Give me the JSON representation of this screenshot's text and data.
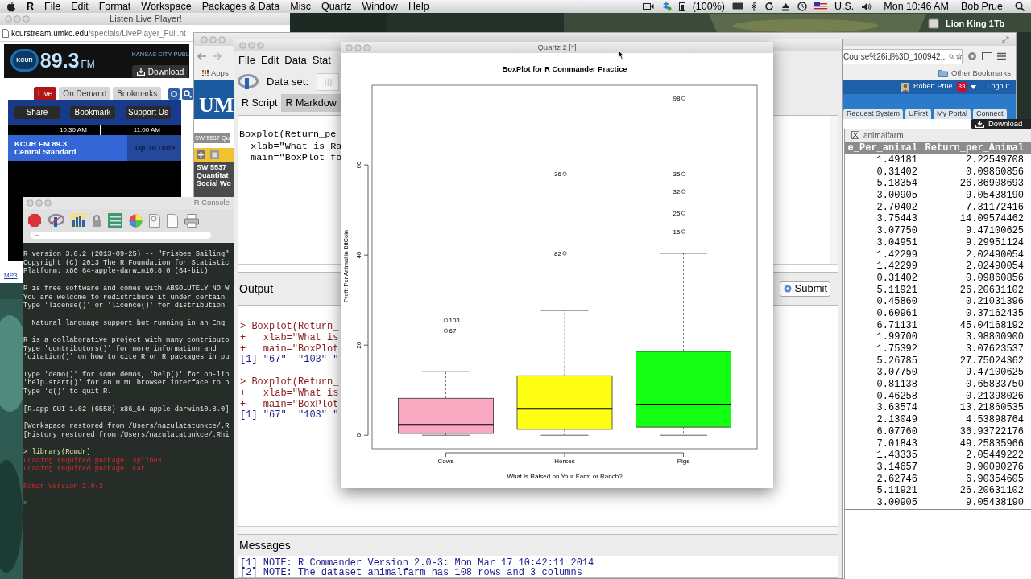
{
  "menu_bar": {
    "app": "R",
    "items": [
      "File",
      "Edit",
      "Format",
      "Workspace",
      "Packages & Data",
      "Misc",
      "Quartz",
      "Window",
      "Help"
    ],
    "battery": "(100%)",
    "input_source": "U.S.",
    "clock": "Mon 10:46 AM",
    "user": "Bob Prue"
  },
  "desktop_icons": [
    {
      "label": "Lion King 1Tb"
    }
  ],
  "radio_window": {
    "title": "Listen Live Player!",
    "url_host": "kcurstream.umkc.edu",
    "url_path": "/specials/LivePlayer_Full.ht",
    "logo": "KCUR",
    "frequency": "89.3",
    "band": "FM",
    "station": "KANSAS CITY PUBL",
    "download": "Download",
    "tabs": [
      {
        "label": "Live",
        "selected": true
      },
      {
        "label": "On Demand",
        "selected": false
      },
      {
        "label": "Bookmarks",
        "selected": false
      }
    ],
    "buttons": [
      "Share",
      "Bookmark",
      "Support Us"
    ],
    "times": [
      "10:30 AM",
      "11:00 AM"
    ],
    "now_playing": {
      "station": "KCUR FM 89.3",
      "show": "Central Standard"
    },
    "next_show": "Up To Date",
    "link": "MP3"
  },
  "browser_window": {
    "bookmark": "Apps",
    "logo": "UM",
    "url": "Course%26id%3D_100942...",
    "other_bookmarks": "Other Bookmarks",
    "user": "Robert Prue",
    "notifications": "83",
    "logout": "Logout",
    "tabs": [
      "Request System",
      "UFirst",
      "My Portal",
      "Connect"
    ],
    "course_tag": "SW 5537 Qu",
    "sidebar": [
      "SW 5537",
      "Quantitat",
      "Social Wo"
    ]
  },
  "download_button": "Download",
  "data_window": {
    "title": "animalfarm",
    "columns": [
      "e_Per_animal",
      "Return_per_Animal"
    ],
    "rows": [
      [
        "1.49181",
        "2.22549708"
      ],
      [
        "0.31402",
        "0.09860856"
      ],
      [
        "5.18354",
        "26.86908693"
      ],
      [
        "3.00905",
        "9.05438190"
      ],
      [
        "2.70402",
        "7.31172416"
      ],
      [
        "3.75443",
        "14.09574462"
      ],
      [
        "3.07750",
        "9.47100625"
      ],
      [
        "3.04951",
        "9.29951124"
      ],
      [
        "1.42299",
        "2.02490054"
      ],
      [
        "1.42299",
        "2.02490054"
      ],
      [
        "0.31402",
        "0.09860856"
      ],
      [
        "5.11921",
        "26.20631102"
      ],
      [
        "0.45860",
        "0.21031396"
      ],
      [
        "0.60961",
        "0.37162435"
      ],
      [
        "6.71131",
        "45.04168192"
      ],
      [
        "1.99700",
        "3.98800900"
      ],
      [
        "1.75392",
        "3.07623537"
      ],
      [
        "5.26785",
        "27.75024362"
      ],
      [
        "3.07750",
        "9.47100625"
      ],
      [
        "0.81138",
        "0.65833750"
      ],
      [
        "0.46258",
        "0.21398026"
      ],
      [
        "3.63574",
        "13.21860535"
      ],
      [
        "2.13049",
        "4.53898764"
      ],
      [
        "6.07760",
        "36.93722176"
      ],
      [
        "7.01843",
        "49.25835966"
      ],
      [
        "1.43335",
        "2.05449222"
      ],
      [
        "3.14657",
        "9.90090276"
      ],
      [
        "2.62746",
        "6.90354605"
      ],
      [
        "5.11921",
        "26.20631102"
      ],
      [
        "3.00905",
        "9.05438190"
      ]
    ]
  },
  "console": {
    "title": "R Console",
    "path": "~",
    "lines": [
      {
        "kind": "output",
        "text": "R version 3.0.2 (2013-09-25) -- \"Frisbee Sailing\""
      },
      {
        "kind": "output",
        "text": "Copyright (C) 2013 The R Foundation for Statistic"
      },
      {
        "kind": "output",
        "text": "Platform: x86_64-apple-darwin10.8.0 (64-bit)"
      },
      {
        "kind": "gap"
      },
      {
        "kind": "output",
        "text": "R is free software and comes with ABSOLUTELY NO W"
      },
      {
        "kind": "output",
        "text": "You are welcome to redistribute it under certain"
      },
      {
        "kind": "output",
        "text": "Type 'license()' or 'licence()' for distribution"
      },
      {
        "kind": "gap"
      },
      {
        "kind": "output",
        "text": "  Natural language support but running in an Eng"
      },
      {
        "kind": "gap"
      },
      {
        "kind": "output",
        "text": "R is a collaborative project with many contributo"
      },
      {
        "kind": "output",
        "text": "Type 'contributors()' for more information and"
      },
      {
        "kind": "output",
        "text": "'citation()' on how to cite R or R packages in pu"
      },
      {
        "kind": "gap"
      },
      {
        "kind": "output",
        "text": "Type 'demo()' for some demos, 'help()' for on-lin"
      },
      {
        "kind": "output",
        "text": "'help.start()' for an HTML browser interface to h"
      },
      {
        "kind": "output",
        "text": "Type 'q()' to quit R."
      },
      {
        "kind": "gap"
      },
      {
        "kind": "output",
        "text": "[R.app GUI 1.62 (6558) x86_64-apple-darwin10.8.0]"
      },
      {
        "kind": "gap"
      },
      {
        "kind": "output",
        "text": "[Workspace restored from /Users/nazulatatunkce/.R"
      },
      {
        "kind": "output",
        "text": "[History restored from /Users/nazulatatunkce/.Rhi"
      },
      {
        "kind": "gap"
      },
      {
        "kind": "command",
        "text": "> library(Rcmdr)"
      },
      {
        "kind": "message",
        "text": "Loading required package: splines"
      },
      {
        "kind": "message",
        "text": "Loading required package: car"
      },
      {
        "kind": "gap"
      },
      {
        "kind": "message",
        "text": "Rcmdr Version 2.0-3"
      },
      {
        "kind": "gap"
      },
      {
        "kind": "prompt",
        "text": ">"
      }
    ]
  },
  "rcmdr_window": {
    "menu": [
      "File",
      "Edit",
      "Data",
      "Stat"
    ],
    "dataset_label": "Data set:",
    "tabs": [
      {
        "label": "R Script",
        "selected": true
      },
      {
        "label": "R Markdow",
        "selected": false
      }
    ],
    "script": [
      "Boxplot(Return_pe",
      "  xlab=\"What is Ra",
      "  main=\"BoxPlot fo"
    ],
    "output_label": "Output",
    "submit": "Submit",
    "output": [
      {
        "kind": "command",
        "text": "> Boxplot(Return_"
      },
      {
        "kind": "command",
        "text": "+   xlab=\"What is"
      },
      {
        "kind": "command",
        "text": "+   main=\"BoxPlot"
      },
      {
        "kind": "result",
        "text": "[1] \"67\"  \"103\" \""
      },
      {
        "kind": "gap"
      },
      {
        "kind": "command",
        "text": "> Boxplot(Return_"
      },
      {
        "kind": "command",
        "text": "+   xlab=\"What is"
      },
      {
        "kind": "command",
        "text": "+   main=\"BoxPlot"
      },
      {
        "kind": "result",
        "text": "[1] \"67\"  \"103\" \""
      }
    ],
    "messages_label": "Messages",
    "messages": [
      "[1] NOTE: R Commander Version 2.0-3: Mon Mar 17 10:42:11 2014",
      "[2] NOTE: The dataset animalfarm has 108 rows and 3 columns"
    ]
  },
  "plot_window": {
    "title": "Quartz 2 [*]",
    "plot": {
      "title": "BoxPlot for R Commander Practice",
      "xlabel": "What is Raised on Your Farm or Ranch?",
      "ylabel": "Profit Per Animal in BitCoin",
      "y_tick_labels": [
        "0",
        "20",
        "40",
        "60"
      ],
      "groups": [
        {
          "label": "Cows",
          "color": "#f8a8c0",
          "outlier_labels": [
            "103",
            "67"
          ]
        },
        {
          "label": "Horses",
          "color": "#ffff14",
          "outlier_labels": [
            "36",
            "82"
          ]
        },
        {
          "label": "Pigs",
          "color": "#14ff14",
          "outlier_labels": [
            "98",
            "35",
            "32",
            "25",
            "15"
          ]
        }
      ]
    }
  }
}
